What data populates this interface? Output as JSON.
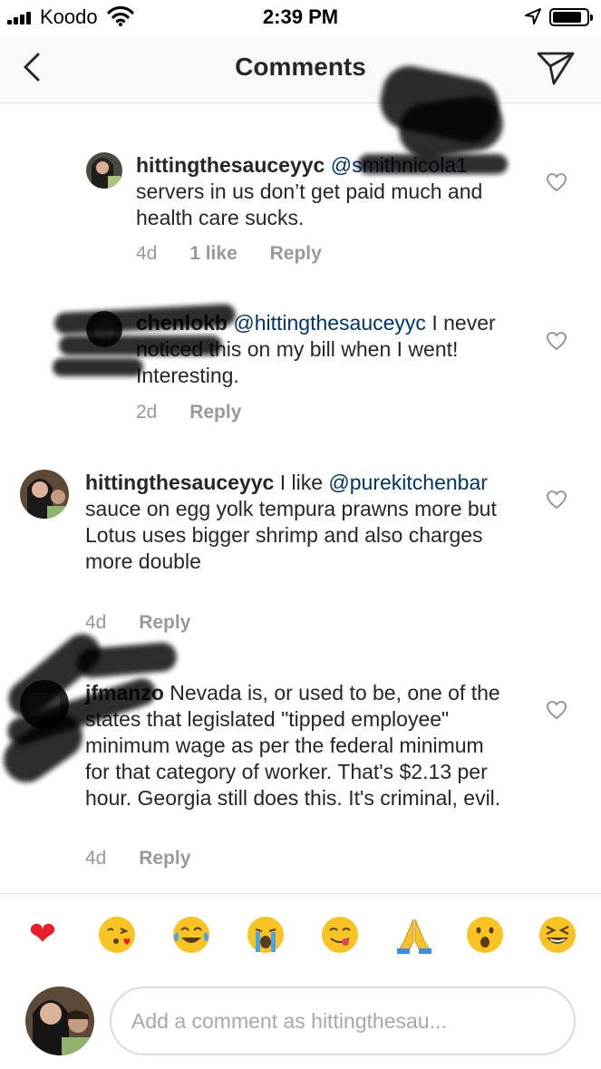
{
  "status_bar": {
    "carrier": "Koodo",
    "time": "2:39 PM"
  },
  "header": {
    "title": "Comments"
  },
  "comments": [
    {
      "username": "hittingthesauceyyc",
      "mention": "@smithnicola1",
      "text": "servers in us don’t get paid much and health care sucks.",
      "age": "4d",
      "likes": "1 like",
      "reply": "Reply"
    },
    {
      "username": "chenlokb",
      "mention": "@hittingthesauceyyc",
      "text": "I never noticed this on my bill when I went! Interesting.",
      "age": "2d",
      "reply": "Reply"
    },
    {
      "username": "hittingthesauceyyc",
      "text": "I like",
      "mention": "@purekitchenbar",
      "text2": "sauce on egg yolk tempura prawns more but Lotus uses bigger shrimp and also charges more double",
      "age": "4d",
      "reply": "Reply"
    },
    {
      "username": "jfmanzo",
      "text": "Nevada is, or used to be, one of the states that legislated \"tipped employee\" minimum wage as per the federal minimum for that category of worker. That's $2.13 per hour. Georgia still does this. It's criminal, evil.",
      "age": "4d",
      "reply": "Reply"
    }
  ],
  "emoji_bar": [
    {
      "icon": "red-heart",
      "glyph": "❤"
    },
    {
      "icon": "face-blowing-kiss",
      "glyph": ""
    },
    {
      "icon": "face-tears-of-joy",
      "glyph": ""
    },
    {
      "icon": "loudly-crying-face",
      "glyph": ""
    },
    {
      "icon": "face-savoring-food",
      "glyph": ""
    },
    {
      "icon": "folded-hands",
      "glyph": ""
    },
    {
      "icon": "face-open-mouth",
      "glyph": ""
    },
    {
      "icon": "squinting-face",
      "glyph": ""
    }
  ],
  "compose": {
    "placeholder": "Add a comment as hittingthesau..."
  },
  "colors": {
    "mention": "#003569",
    "meta": "#999999",
    "text": "#262626",
    "heart": "#e0245e"
  }
}
